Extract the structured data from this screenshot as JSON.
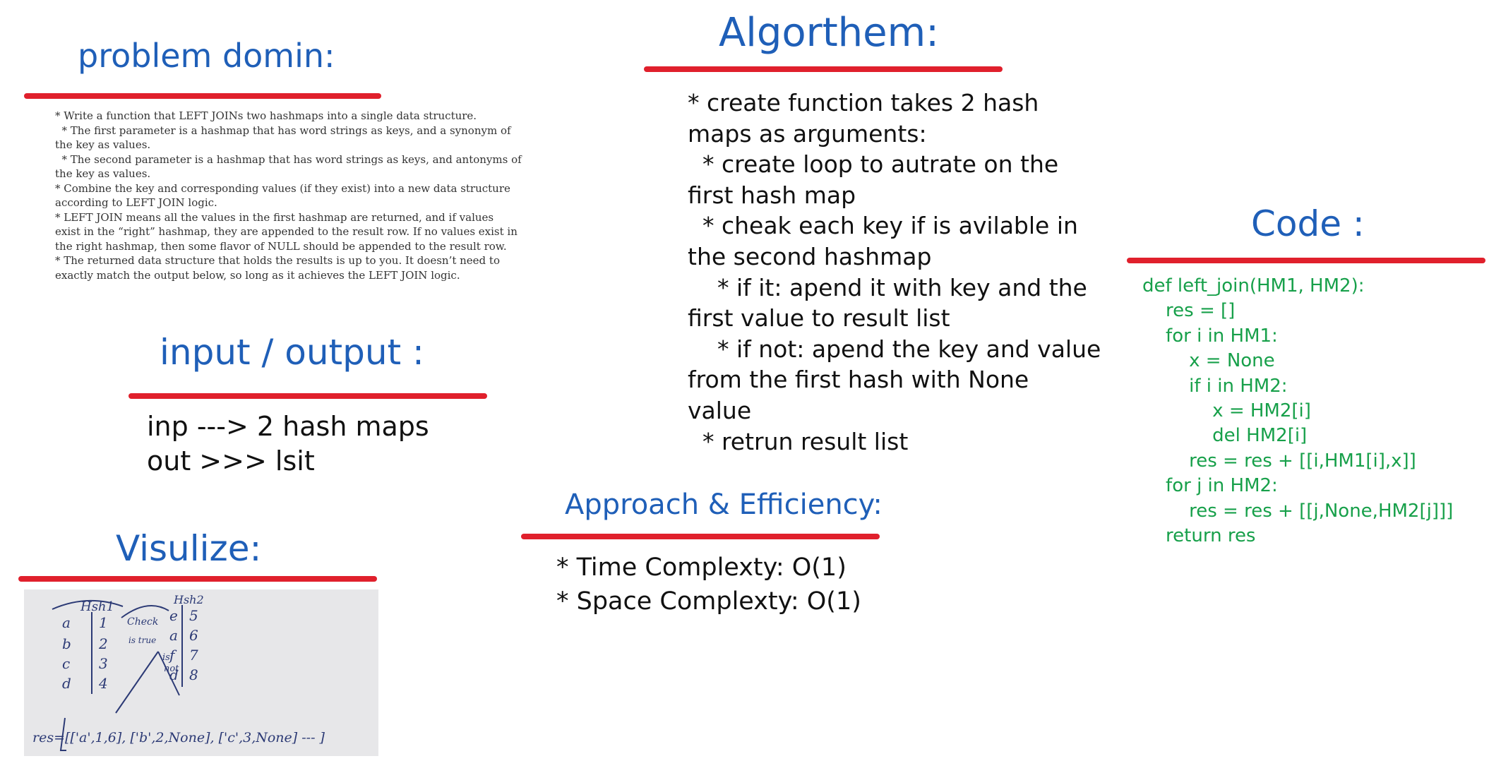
{
  "problem": {
    "heading": "problem domin:",
    "lines": [
      "* Write a function that LEFT JOINs two hashmaps into a single data structure.",
      "  * The first parameter is a hashmap that has word strings as keys, and a synonym of",
      "the key as values.",
      "  * The second parameter is a hashmap that has word strings as keys, and antonyms of",
      "the key as values.",
      "* Combine the key and corresponding values (if they exist) into a new data structure",
      "according to LEFT JOIN logic.",
      "* LEFT JOIN means all the values in the first hashmap are returned, and if values",
      "exist in the “right” hashmap, they are appended to the result row. If no values exist in",
      "the right hashmap, then some flavor of NULL should be appended to the result row.",
      "* The returned data structure that holds the results is up to you. It doesn’t need to",
      "exactly match the output below, so long as it achieves the LEFT JOIN logic."
    ]
  },
  "io": {
    "heading": "input / output :",
    "lines": [
      "inp ---> 2 hash maps",
      "out >>> lsit"
    ]
  },
  "visualize": {
    "heading": "Visulize:",
    "sketch": {
      "table1_title": "Hsh1",
      "table1_keys": [
        "a",
        "b",
        "c",
        "d"
      ],
      "table1_values": [
        "1",
        "2",
        "3",
        "4"
      ],
      "table2_title": "Hsh2",
      "table2_keys": [
        "e",
        "a",
        "f",
        "d"
      ],
      "table2_values": [
        "5",
        "6",
        "7",
        "8"
      ],
      "check_label": "Check",
      "is_true_label": "is true",
      "is_not_label_1": "is",
      "is_not_label_2": "not",
      "result_line": "res=[['a',1,6], ['b',2,None], ['c',3,None] --- ]"
    }
  },
  "algorithm": {
    "heading": "Algorthem:",
    "lines": [
      "* create function takes 2 hash",
      "maps as arguments:",
      "  * create loop to autrate on the",
      "first hash map",
      "  * cheak each key if is avilable in",
      "the second hashmap",
      "    * if it: apend it with key and the",
      "first value to result list",
      "    * if not: apend the key and value",
      "from the first hash with None",
      "value",
      "  * retrun result list"
    ]
  },
  "approach": {
    "heading": "Approach & Efficiency:",
    "lines": [
      "* Time Complexty: O(1)",
      "* Space Complexty: O(1)"
    ]
  },
  "code": {
    "heading": "Code :",
    "lines": [
      "def left_join(HM1, HM2):",
      "    res = []",
      "    for i in HM1:",
      "        x = None",
      "        if i in HM2:",
      "            x = HM2[i]",
      "            del HM2[i]",
      "        res = res + [[i,HM1[i],x]]",
      "    for j in HM2:",
      "        res = res + [[j,None,HM2[j]]]",
      "    return res"
    ]
  },
  "colors": {
    "heading": "#1f5fb8",
    "underline": "#e0202c",
    "code": "#17a04a",
    "sketch_ink": "#2c3a75"
  }
}
